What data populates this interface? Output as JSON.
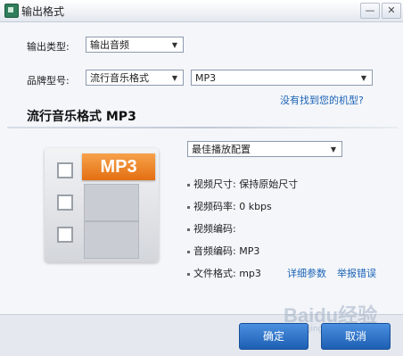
{
  "window": {
    "title": "输出格式",
    "minimize_icon": "minimize-icon",
    "close_icon": "close-icon",
    "minimize_glyph": "—",
    "close_glyph": "✕"
  },
  "output_type": {
    "label": "输出类型:",
    "value": "输出音频"
  },
  "brand_model": {
    "label": "品牌型号:",
    "brand_value": "流行音乐格式",
    "model_value": "MP3"
  },
  "link_missing_model": "没有找到您的机型?",
  "section": {
    "title": "流行音乐格式 MP3"
  },
  "illustration": {
    "badge_text": "MP3",
    "icon": "film-strip-icon"
  },
  "preset": {
    "value": "最佳播放配置"
  },
  "info": [
    {
      "text": "视频尺寸: 保持原始尺寸"
    },
    {
      "text": "视频码率: 0 kbps"
    },
    {
      "text": "视频编码:"
    },
    {
      "text": "音频编码: MP3"
    },
    {
      "text": "文件格式: mp3"
    }
  ],
  "links": {
    "details": "详细参数",
    "report_error": "举报错误"
  },
  "buttons": {
    "ok": "确定",
    "cancel": "取消"
  },
  "watermark": {
    "brand": "Baidu经验",
    "url": "jingyan.baidu.com"
  },
  "colors": {
    "accent": "#1d5fb3",
    "badge": "#e36f12",
    "link": "#1a62b5"
  }
}
